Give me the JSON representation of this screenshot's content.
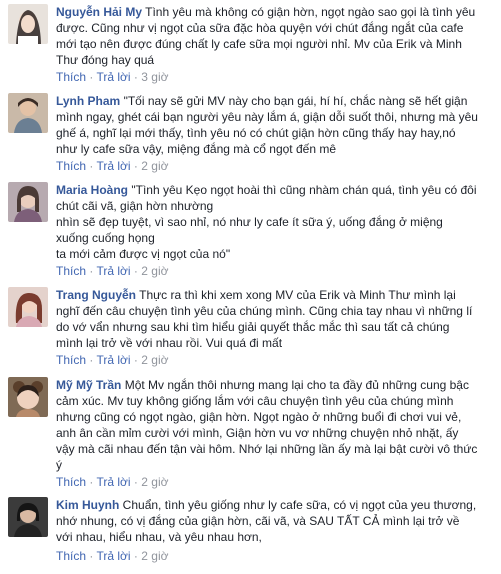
{
  "comments": [
    {
      "author": "Nguyễn Hải My",
      "lines": [
        " Tình yêu mà không có giận hờn, ngọt ngào sao gọi là tình yêu",
        "được. Cũng như vị ngọt của sữa đặc hòa quyện với chút đắng ngắt của cafe",
        "mới tạo nên được đúng chất ly cafe sữa mọi người nhỉ. Mv của Erik và Minh",
        "Thư đóng hay quá"
      ],
      "like": "Thích",
      "reply": "Trả lời",
      "time": "3 giờ"
    },
    {
      "author": "Lynh Pham",
      "lines": [
        " \"Tối nay sẽ gửi MV này cho bạn gái, hí hí, chắc nàng sẽ hết giận",
        "mình ngay, ghét cái bạn người yêu này lắm á, giận dỗi suốt thôi, nhưng mà yêu",
        "ghế á, nghĩ lại mới thấy, tình yêu nó có chút giận hờn cũng thấy hay hay,nó",
        "như ly cafe sữa vậy, miệng đắng mà cổ ngọt đến mê"
      ],
      "like": "Thích",
      "reply": "Trả lời",
      "time": "2 giờ"
    },
    {
      "author": "Maria Hoàng",
      "lines": [
        " \"Tình yêu Kẹo ngọt hoài thì cũng nhàm chán quá, tình yêu có đôi",
        "chút cãi vã, giận hờn nhường",
        "nhìn sẽ đẹp tuyệt, vì sao nhỉ, nó như ly cafe ít sữa ý, uống đắng ở miệng",
        "xuống cuống họng",
        "ta mới cảm được vị ngọt của nó\""
      ],
      "like": "Thích",
      "reply": "Trả lời",
      "time": "2 giờ"
    },
    {
      "author": "Trang Nguyễn",
      "lines": [
        " Thực ra thì khi xem xong MV của Erik và Minh Thư mình lại",
        "nghĩ đến câu chuyện tình yêu của chúng mình. Cũng chia tay nhau vì những lí",
        "do vớ vẩn nhưng sau khi tìm hiểu giải quyết thắc mắc thì sau tất cả chúng",
        "mình lại trở về với nhau rồi. Vui quá đi mất"
      ],
      "like": "Thích",
      "reply": "Trả lời",
      "time": "2 giờ"
    },
    {
      "author": "Mỹ Mỹ Trần",
      "lines": [
        " Một Mv ngắn thôi nhưng mang lại cho ta đầy đủ những cung bậc",
        "cảm xúc. Mv tuy không giống lắm với câu chuyện tình yêu của chúng mình",
        "nhưng cũng có ngọt ngào, giận hờn. Ngọt ngào ở những buổi đi chơi vui vẻ,",
        "anh ân cần mỉm cười với mình, Giận hờn vu vơ những chuyện nhỏ nhặt, ấy",
        "vậy mà cãi nhau đến tận vài hôm. Nhớ lại những lần ấy mà lại bật cười vô thức",
        "ý"
      ],
      "like": "Thích",
      "reply": "Trả lời",
      "time": "2 giờ"
    },
    {
      "author": "Kim Huynh",
      "lines": [
        " Chuẩn, tình yêu giống như ly cafe sữa, có vị ngọt của yeu thương,",
        "nhớ nhung, có vị đắng của giận hờn, cãi vã, và SAU TẤT CẢ mình lại trở về",
        "với nhau, hiểu nhau, và yêu nhau hơn,"
      ],
      "like": "Thích",
      "reply": "Trả lời",
      "time": "2 giờ"
    }
  ],
  "separator": "·"
}
